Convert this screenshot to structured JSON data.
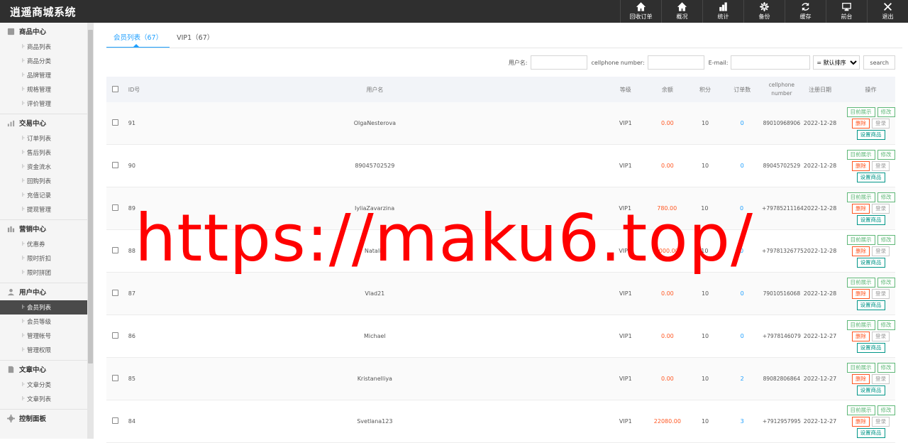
{
  "app": {
    "title": "逍遥商城系统"
  },
  "topnav": [
    {
      "label": "回收订单",
      "icon": "home-icon"
    },
    {
      "label": "概况",
      "icon": "home-icon"
    },
    {
      "label": "统计",
      "icon": "bar-chart-icon"
    },
    {
      "label": "备份",
      "icon": "gear-icon"
    },
    {
      "label": "缓存",
      "icon": "refresh-icon"
    },
    {
      "label": "前台",
      "icon": "monitor-icon"
    },
    {
      "label": "退出",
      "icon": "close-icon"
    }
  ],
  "sidebar": {
    "groups": [
      {
        "title": "商品中心",
        "icon": "box-icon",
        "items": [
          "商品列表",
          "商品分类",
          "品牌管理",
          "规格管理",
          "评价管理"
        ]
      },
      {
        "title": "交易中心",
        "icon": "bar-chart-icon",
        "items": [
          "订单列表",
          "售后列表",
          "资金流水",
          "回购列表",
          "充值记录",
          "提现管理"
        ]
      },
      {
        "title": "营销中心",
        "icon": "chart-icon",
        "items": [
          "优惠券",
          "限时折扣",
          "限时拼团"
        ]
      },
      {
        "title": "用户中心",
        "icon": "user-icon",
        "items": [
          "会员列表",
          "会员等级",
          "管理帐号",
          "管理权限"
        ]
      },
      {
        "title": "文章中心",
        "icon": "document-icon",
        "items": [
          "文章分类",
          "文章列表"
        ]
      },
      {
        "title": "控制面板",
        "icon": "gear-icon",
        "items": []
      }
    ],
    "active": "会员列表"
  },
  "tabs": [
    {
      "label": "会员列表（67）",
      "active": true
    },
    {
      "label": "VIP1（67）",
      "active": false
    }
  ],
  "filters": {
    "username_label": "用户名:",
    "phone_label": "cellphone number:",
    "email_label": "E-mail:",
    "sort_selected": "= 默认排序 =",
    "search_label": "search"
  },
  "table": {
    "headers": {
      "id": "ID号",
      "username": "用户名",
      "level": "等级",
      "balance": "余额",
      "points": "积分",
      "orders": "订单数",
      "phone": "cellphone number",
      "date": "注册日期",
      "ops": "操作"
    },
    "op_labels": {
      "show": "目前展示",
      "edit": "修改",
      "delete": "删除",
      "login": "登录",
      "set_goods": "设置商品"
    },
    "rows": [
      {
        "id": "91",
        "username": "OlgaNesterova",
        "level": "VIP1",
        "balance": "0.00",
        "points": "10",
        "orders": "0",
        "phone": "89010968906",
        "date": "2022-12-28"
      },
      {
        "id": "90",
        "username": "89045702529",
        "level": "VIP1",
        "balance": "0.00",
        "points": "10",
        "orders": "0",
        "phone": "89045702529",
        "date": "2022-12-28"
      },
      {
        "id": "89",
        "username": "IyliaZavarzina",
        "level": "VIP1",
        "balance": "780.00",
        "points": "10",
        "orders": "0",
        "phone": "+79785211164",
        "date": "2022-12-28"
      },
      {
        "id": "88",
        "username": "Natalia",
        "level": "VIP1",
        "balance": "1000.00",
        "points": "10",
        "orders": "0",
        "phone": "+79781326775",
        "date": "2022-12-28"
      },
      {
        "id": "87",
        "username": "Vlad21",
        "level": "VIP1",
        "balance": "0.00",
        "points": "10",
        "orders": "0",
        "phone": "79010516068",
        "date": "2022-12-28"
      },
      {
        "id": "86",
        "username": "Michael",
        "level": "VIP1",
        "balance": "0.00",
        "points": "10",
        "orders": "0",
        "phone": "+7978146079",
        "date": "2022-12-27"
      },
      {
        "id": "85",
        "username": "Kristanelliya",
        "level": "VIP1",
        "balance": "0.00",
        "points": "10",
        "orders": "2",
        "phone": "89082806864",
        "date": "2022-12-27"
      },
      {
        "id": "84",
        "username": "Svetlana123",
        "level": "VIP1",
        "balance": "22080.00",
        "points": "10",
        "orders": "3",
        "phone": "+7912957995",
        "date": "2022-12-27"
      }
    ]
  },
  "watermark": "https://maku6.top/",
  "colors": {
    "accent": "#1e9fff",
    "topbar": "#2f2f2f",
    "balance": "#ff5722",
    "watermark": "#ff0000"
  }
}
